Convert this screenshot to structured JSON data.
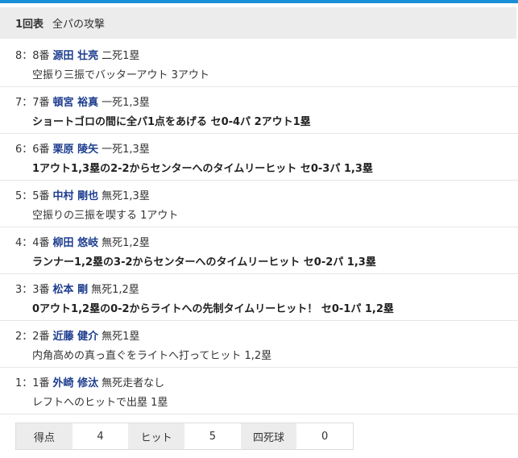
{
  "colors": {
    "accent_bar": "#1a8fd6",
    "player_link": "#1d3d8f",
    "header_bg": "#ececec"
  },
  "header": {
    "inning": "1回表",
    "team": "全パの攻撃"
  },
  "plays": [
    {
      "order": "8：8番",
      "player": "源田 壮亮",
      "situation": "二死1塁",
      "result": "空振り三振でバッターアウト 3アウト",
      "emphasis": false
    },
    {
      "order": "7：7番",
      "player": "頓宮 裕真",
      "situation": "一死1,3塁",
      "result": "ショートゴロの間に全パ1点をあげる セ0-4パ 2アウト1塁",
      "emphasis": true
    },
    {
      "order": "6：6番",
      "player": "栗原 陵矢",
      "situation": "一死1,3塁",
      "result": "1アウト1,3塁の2-2からセンターへのタイムリーヒット セ0-3パ 1,3塁",
      "emphasis": true
    },
    {
      "order": "5：5番",
      "player": "中村 剛也",
      "situation": "無死1,3塁",
      "result": "空振りの三振を喫する 1アウト",
      "emphasis": false
    },
    {
      "order": "4：4番",
      "player": "柳田 悠岐",
      "situation": "無死1,2塁",
      "result": "ランナー1,2塁の3-2からセンターへのタイムリーヒット セ0-2パ 1,3塁",
      "emphasis": true
    },
    {
      "order": "3：3番",
      "player": "松本 剛",
      "situation": "無死1,2塁",
      "result": "0アウト1,2塁の0-2からライトへの先制タイムリーヒット！ セ0-1パ 1,2塁",
      "emphasis": true
    },
    {
      "order": "2：2番",
      "player": "近藤 健介",
      "situation": "無死1塁",
      "result": "内角高めの真っ直ぐをライトへ打ってヒット 1,2塁",
      "emphasis": false
    },
    {
      "order": "1：1番",
      "player": "外崎 修汰",
      "situation": "無死走者なし",
      "result": "レフトへのヒットで出塁 1塁",
      "emphasis": false
    }
  ],
  "summary": {
    "runs_label": "得点",
    "runs": "4",
    "hits_label": "ヒット",
    "hits": "5",
    "walks_label": "四死球",
    "walks": "0"
  }
}
